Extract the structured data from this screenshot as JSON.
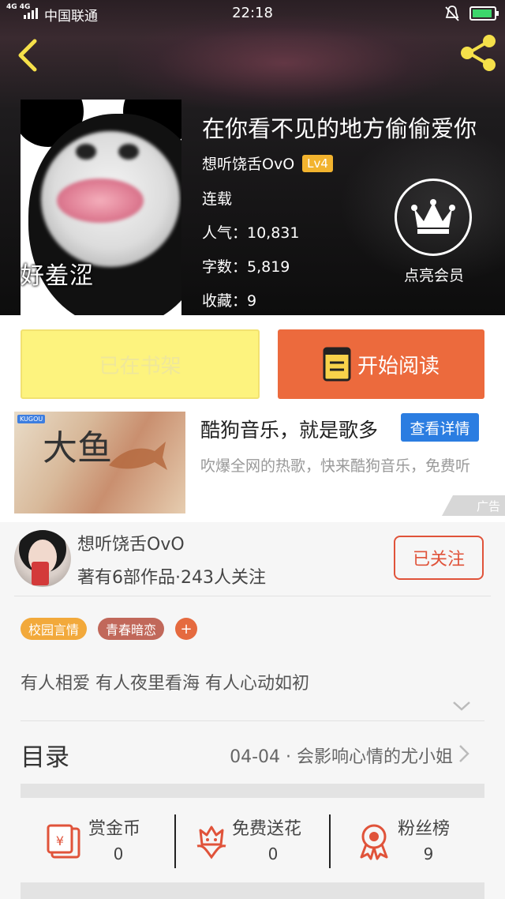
{
  "status_bar": {
    "network": "4G 4G",
    "carrier": "中国联通",
    "time": "22:18"
  },
  "book": {
    "title": "在你看不见的地方偷偷爱你",
    "cover_caption": "好羞涩",
    "author": "想听饶舌OvO",
    "level": "Lv4",
    "status": "连载",
    "popularity_label": "人气：10,831",
    "words_label": "字数：5,819",
    "favorites_label": "收藏：9",
    "vip_label": "点亮会员"
  },
  "actions": {
    "shelf_label": "已在书架",
    "read_label": "开始阅读"
  },
  "ad": {
    "brand": "KUGOU",
    "image_text": "大鱼",
    "title": "酷狗音乐，就是歌多",
    "detail_button": "查看详情",
    "description": "吹爆全网的热歌，快来酷狗音乐，免费听",
    "tag": "广告"
  },
  "author_card": {
    "name": "想听饶舌OvO",
    "stats": "著有6部作品·243人关注",
    "follow_label": "已关注"
  },
  "tags": [
    {
      "label": "校园言情",
      "color": "#f2a93b"
    },
    {
      "label": "青春暗恋",
      "color": "#c1685a"
    }
  ],
  "tag_add": "+",
  "intro": "有人相爱 有人夜里看海 有人心动如初",
  "toc": {
    "label": "目录",
    "latest": "04-04 · 会影响心情的尤小姐"
  },
  "stats": [
    {
      "name": "赏金币",
      "value": "0",
      "icon": "reward-coin-icon"
    },
    {
      "name": "免费送花",
      "value": "0",
      "icon": "flower-icon"
    },
    {
      "name": "粉丝榜",
      "value": "9",
      "icon": "fan-ranking-icon"
    }
  ],
  "colors": {
    "accent_orange": "#ec6a3d",
    "shelf_yellow": "#fdf37e",
    "ad_blue": "#2b7de1",
    "follow_red": "#e0533a",
    "header_icon_yellow": "#f5e04a"
  }
}
